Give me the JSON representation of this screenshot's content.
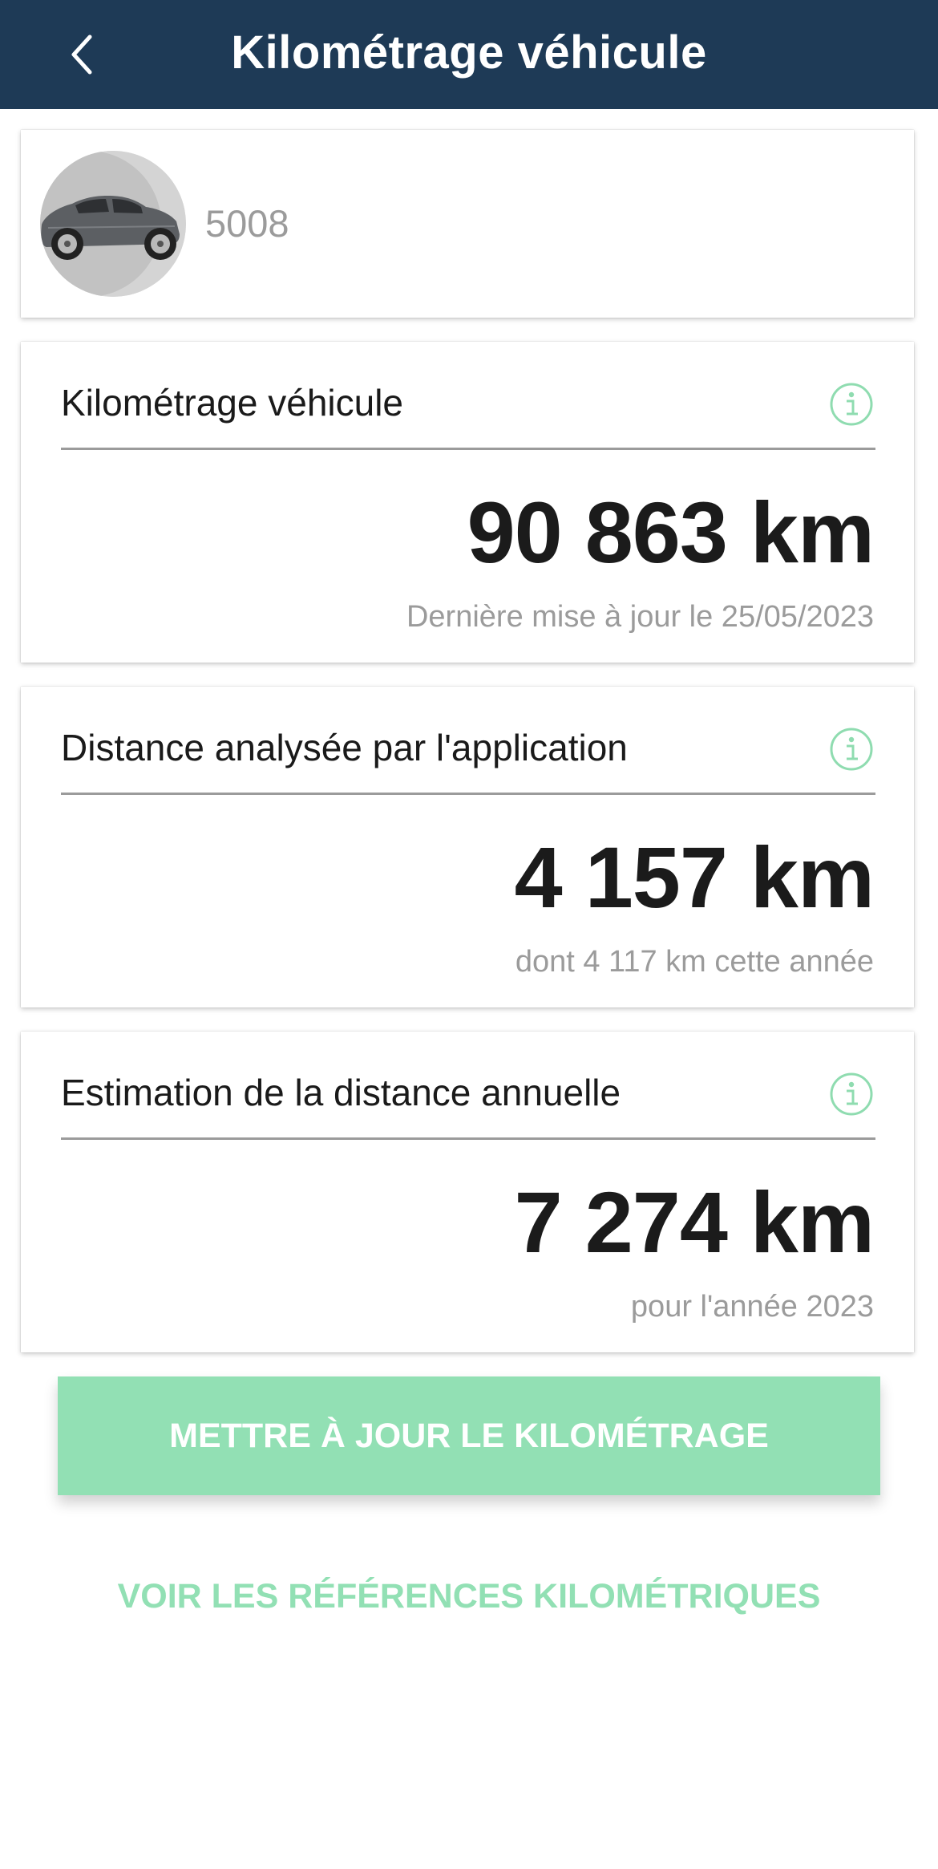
{
  "header": {
    "title": "Kilométrage véhicule",
    "background_color": "#1e3a56"
  },
  "vehicle": {
    "name": "5008"
  },
  "metrics": [
    {
      "label": "Kilométrage véhicule",
      "value": "90 863 km",
      "subtitle": "Dernière mise à jour le 25/05/2023"
    },
    {
      "label": "Distance analysée par l'application",
      "value": "4 157 km",
      "subtitle": "dont 4 117 km cette année"
    },
    {
      "label": "Estimation de la distance annuelle",
      "value": "7 274 km",
      "subtitle": "pour l'année 2023"
    }
  ],
  "actions": {
    "update_label": "METTRE À JOUR LE KILOMÉTRAGE",
    "references_label": "VOIR LES RÉFÉRENCES KILOMÉTRIQUES"
  },
  "colors": {
    "accent": "#92e0b4",
    "info_icon": "#8fdcb0",
    "text_muted": "#9b9b9b"
  },
  "icons": {
    "back": "chevron-left-icon",
    "info": "info-icon",
    "vehicle": "car-icon"
  }
}
